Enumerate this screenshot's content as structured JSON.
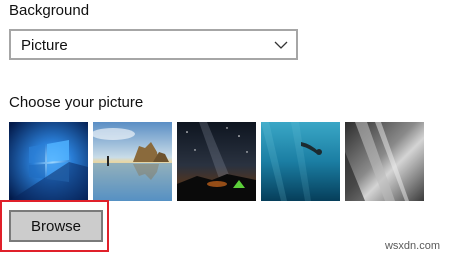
{
  "background": {
    "label": "Background",
    "selected": "Picture"
  },
  "picture": {
    "label": "Choose your picture",
    "thumbnails": [
      {
        "name": "windows-light"
      },
      {
        "name": "beach-rocks"
      },
      {
        "name": "night-sky-tent"
      },
      {
        "name": "underwater-swimmer"
      },
      {
        "name": "rock-cliff"
      }
    ]
  },
  "browse": {
    "label": "Browse"
  },
  "watermark": "wsxdn.com",
  "colors": {
    "highlight": "#e0202a",
    "button_bg": "#cccccc",
    "button_border": "#7a7a7a",
    "dropdown_border": "#a6a6a6"
  }
}
